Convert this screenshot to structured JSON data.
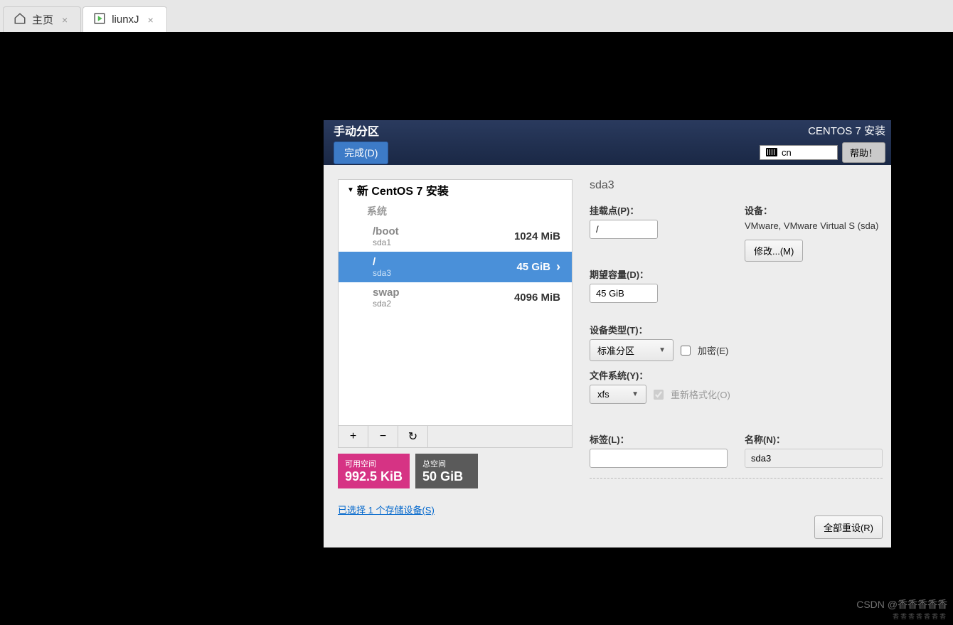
{
  "tabs": [
    {
      "label": "主页",
      "icon": "home"
    },
    {
      "label": "liunxJ",
      "icon": "vm"
    }
  ],
  "installer": {
    "header_title": "手动分区",
    "done_btn": "完成(D)",
    "title": "CENTOS 7 安装",
    "lang": "cn",
    "help_btn": "帮助！",
    "install_heading": "新 CentOS 7 安装",
    "system_label": "系统",
    "partitions": [
      {
        "mount": "/boot",
        "device": "sda1",
        "size": "1024 MiB",
        "selected": false
      },
      {
        "mount": "/",
        "device": "sda3",
        "size": "45 GiB",
        "selected": true
      },
      {
        "mount": "swap",
        "device": "sda2",
        "size": "4096 MiB",
        "selected": false
      }
    ],
    "tools": {
      "add": "+",
      "remove": "−",
      "reload": "↻"
    },
    "space": {
      "avail_label": "可用空间",
      "avail_value": "992.5 KiB",
      "total_label": "总空间",
      "total_value": "50 GiB"
    },
    "device_link": "已选择 1 个存储设备(S)",
    "detail": {
      "title": "sda3",
      "mount_label": "挂载点(P)：",
      "mount_value": "/",
      "device_label": "设备：",
      "device_text": "VMware, VMware Virtual S (sda)",
      "modify_btn": "修改...(M)",
      "capacity_label": "期望容量(D)：",
      "capacity_value": "45 GiB",
      "devtype_label": "设备类型(T)：",
      "devtype_value": "标准分区",
      "encrypt_label": "加密(E)",
      "fs_label": "文件系统(Y)：",
      "fs_value": "xfs",
      "reformat_label": "重新格式化(O)",
      "tag_label": "标签(L)：",
      "tag_value": "",
      "name_label": "名称(N)：",
      "name_value": "sda3",
      "reset_btn": "全部重设(R)"
    }
  },
  "watermark": "CSDN @香香香香香"
}
